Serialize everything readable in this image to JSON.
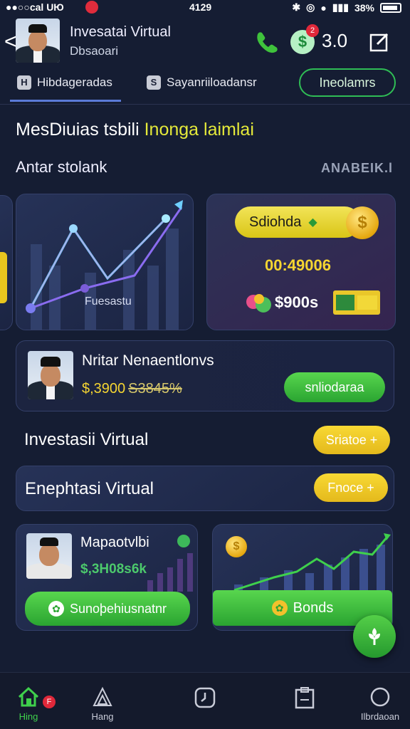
{
  "status_bar": {
    "carrier": "●●○○cal",
    "left_icons": "UЮ",
    "time": "4129",
    "battery_pct": "38%"
  },
  "header": {
    "back": "<",
    "title": "Invesatai Virtual",
    "subtitle": "Dbsaoari",
    "badge": "2",
    "count": "3.0"
  },
  "tabs": [
    {
      "label": "Hibdageradas",
      "icon": "H"
    },
    {
      "label": "Sayanriiloadansr",
      "icon": "S"
    }
  ],
  "tab_pill": "Ineolamrs",
  "headline": {
    "part1": "MesDiuias tsbili ",
    "part2": "Inonga laimlai"
  },
  "section": {
    "title": "Antar stolank",
    "right": "ANABEIK.l"
  },
  "chart_card": {
    "label": "Fuesastu"
  },
  "wallet": {
    "pill_label": "Sdiohda",
    "timer": "00:49006",
    "amount": "$900s"
  },
  "row_stock": {
    "name": "Nritar Nenaentlonvs",
    "price": "$,3900",
    "price_old": "S3845%",
    "button": "snliodaraa"
  },
  "rows": [
    {
      "label": "Investasii Virtual",
      "button": "Sriatoe +"
    },
    {
      "label": "Enephtasi Virtual",
      "button": "Fnoce +"
    }
  ],
  "card_person": {
    "name": "Mapaotvlbi",
    "price": "$,3H08s6k",
    "button": "Sunoþehiusnatnr"
  },
  "card_bonds": {
    "button": "Bonds"
  },
  "bottom_nav": [
    {
      "label": "Hing",
      "icon": "home-icon",
      "badge": "F"
    },
    {
      "label": "Hang",
      "icon": "triangle-icon"
    },
    {
      "label": "",
      "icon": "clock-icon"
    },
    {
      "label": "",
      "icon": "clipboard-icon"
    },
    {
      "label": "Ilbrdaoan",
      "icon": "circle-icon"
    }
  ],
  "colors": {
    "background": "#151d33",
    "accent_green": "#2fbd55",
    "accent_yellow": "#f5d531",
    "accent_blue": "#5b7bd8"
  }
}
